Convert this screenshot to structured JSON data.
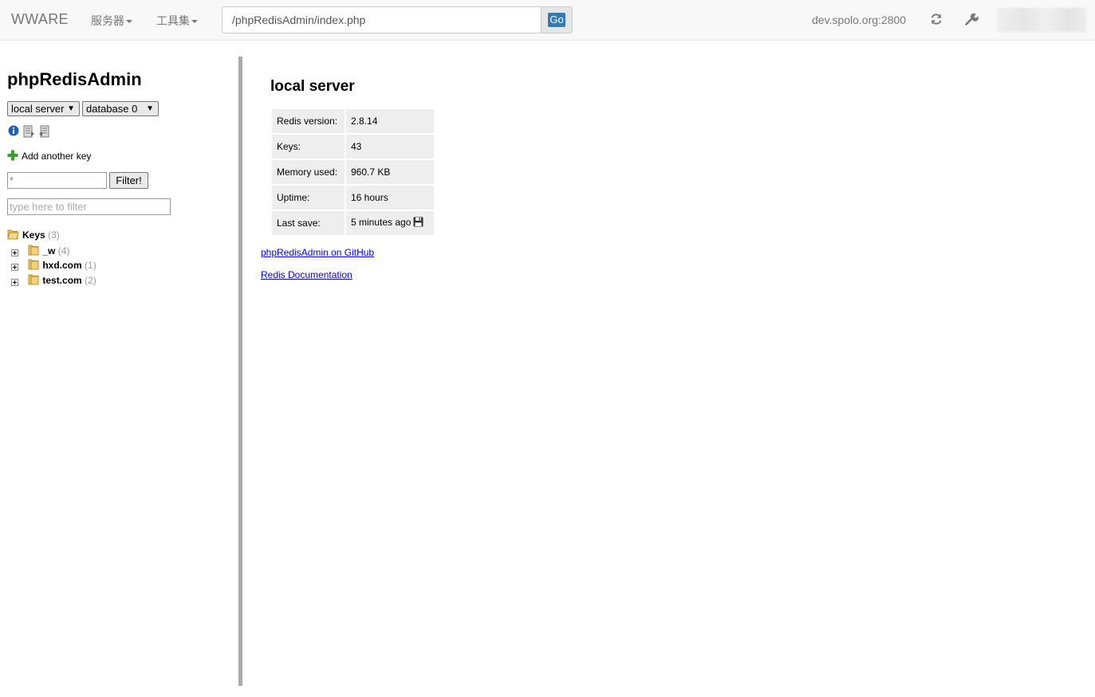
{
  "navbar": {
    "brand": "WWARE",
    "menus": [
      {
        "label": "服务器"
      },
      {
        "label": "工具集"
      }
    ],
    "url": "/phpRedisAdmin/index.php",
    "go_label": "Go",
    "host": "dev.spolo.org:2800",
    "icons": [
      "refresh-icon",
      "wrench-icon"
    ]
  },
  "sidebar": {
    "title": "phpRedisAdmin",
    "server_select": "local server",
    "database_select": "database 0",
    "tools": [
      "info-icon",
      "export-icon",
      "import-icon"
    ],
    "add_key_label": "Add another key",
    "filter_value": "*",
    "filter_button": "Filter!",
    "quick_filter_placeholder": "type here to filter",
    "tree": {
      "root_label": "Keys",
      "root_count": "(3)",
      "items": [
        {
          "name": "_w",
          "count": "(4)"
        },
        {
          "name": "hxd.com",
          "count": "(1)"
        },
        {
          "name": "test.com",
          "count": "(2)"
        }
      ]
    }
  },
  "main": {
    "title": "local server",
    "info": [
      {
        "label": "Redis version:",
        "value": "2.8.14"
      },
      {
        "label": "Keys:",
        "value": "43"
      },
      {
        "label": "Memory used:",
        "value": "960.7 KB"
      },
      {
        "label": "Uptime:",
        "value": "16 hours"
      },
      {
        "label": "Last save:",
        "value": "5 minutes ago"
      }
    ],
    "links": [
      {
        "label": "phpRedisAdmin on GitHub"
      },
      {
        "label": "Redis Documentation"
      }
    ]
  },
  "colors": {
    "navbar_bg": "#f8f8f8",
    "go_button": "#337ab7",
    "divider": "#aaaaaa",
    "table_cell": "#eeeeee",
    "link": "#0000ee"
  }
}
